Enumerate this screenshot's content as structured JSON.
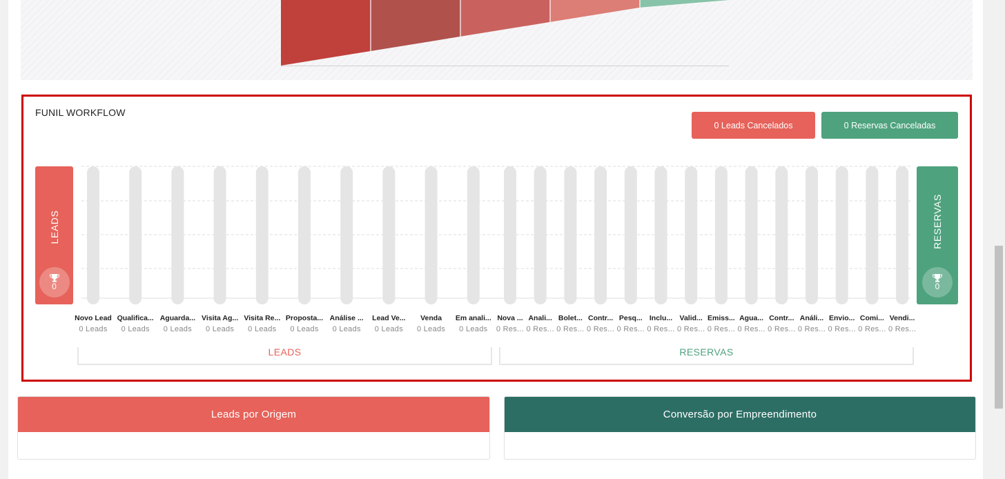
{
  "colors": {
    "leads": "#e6625a",
    "reservas": "#4ea27e",
    "conversao": "#2d6e64",
    "panel_border": "#cc0000"
  },
  "funnel_segments": [
    {
      "color": "#c0403b"
    },
    {
      "color": "#b0514c"
    },
    {
      "color": "#c9625e"
    },
    {
      "color": "#dc7d76"
    },
    {
      "color": "#87c3a8"
    }
  ],
  "workflow": {
    "title": "FUNIL WORKFLOW",
    "leads_cancel_button": "0 Leads Cancelados",
    "reservas_cancel_button": "0 Reservas Canceladas",
    "leads_side_label": "LEADS",
    "leads_side_count": "0",
    "reservas_side_label": "RESERVAS",
    "reservas_side_count": "0",
    "trophy_icon": "trophy-icon",
    "leads_group_label": "LEADS",
    "reservas_group_label": "RESERVAS",
    "stages": [
      {
        "label": "Novo Lead",
        "count": "0 Leads",
        "group": "leads"
      },
      {
        "label": "Qualifica...",
        "count": "0 Leads",
        "group": "leads"
      },
      {
        "label": "Aguarda...",
        "count": "0 Leads",
        "group": "leads"
      },
      {
        "label": "Visita Ag...",
        "count": "0 Leads",
        "group": "leads"
      },
      {
        "label": "Visita Re...",
        "count": "0 Leads",
        "group": "leads"
      },
      {
        "label": "Proposta...",
        "count": "0 Leads",
        "group": "leads"
      },
      {
        "label": "Análise ...",
        "count": "0 Leads",
        "group": "leads"
      },
      {
        "label": "Lead Ve...",
        "count": "0 Leads",
        "group": "leads"
      },
      {
        "label": "Venda",
        "count": "0 Leads",
        "group": "leads"
      },
      {
        "label": "Em anali...",
        "count": "0 Leads",
        "group": "leads"
      },
      {
        "label": "Nova ...",
        "count": "0 Res...",
        "group": "reservas"
      },
      {
        "label": "Anali...",
        "count": "0 Res...",
        "group": "reservas"
      },
      {
        "label": "Bolet...",
        "count": "0 Res...",
        "group": "reservas"
      },
      {
        "label": "Contr...",
        "count": "0 Res...",
        "group": "reservas"
      },
      {
        "label": "Pesq...",
        "count": "0 Res...",
        "group": "reservas"
      },
      {
        "label": "Inclu...",
        "count": "0 Res...",
        "group": "reservas"
      },
      {
        "label": "Valid...",
        "count": "0 Res...",
        "group": "reservas"
      },
      {
        "label": "Emiss...",
        "count": "0 Res...",
        "group": "reservas"
      },
      {
        "label": "Agua...",
        "count": "0 Res...",
        "group": "reservas"
      },
      {
        "label": "Contr...",
        "count": "0 Res...",
        "group": "reservas"
      },
      {
        "label": "Análi...",
        "count": "0 Res...",
        "group": "reservas"
      },
      {
        "label": "Envio...",
        "count": "0 Res...",
        "group": "reservas"
      },
      {
        "label": "Comi...",
        "count": "0 Res...",
        "group": "reservas"
      },
      {
        "label": "Vendi...",
        "count": "0 Res...",
        "group": "reservas"
      }
    ]
  },
  "cards": {
    "leads_origem_title": "Leads por Origem",
    "conversao_title": "Conversão por Empreendimento"
  }
}
